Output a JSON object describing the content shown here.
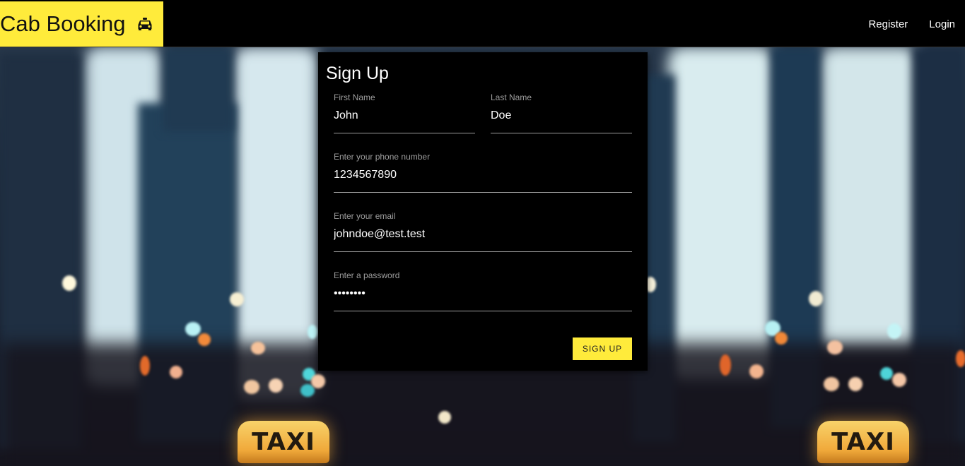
{
  "navbar": {
    "brand": "Cab Booking",
    "brand_icon": "taxi-icon",
    "links": [
      {
        "label": "Register"
      },
      {
        "label": "Login"
      }
    ],
    "brand_color": "#ffeb3b",
    "background": "#000000"
  },
  "background_scene": {
    "taxi_signs": [
      {
        "text": "TAXI"
      },
      {
        "text": "TAXI"
      }
    ]
  },
  "form": {
    "title": "Sign Up",
    "fields": {
      "first_name": {
        "label": "First Name",
        "value": "John"
      },
      "last_name": {
        "label": "Last Name",
        "value": "Doe"
      },
      "phone": {
        "label": "Enter your phone number",
        "value": "1234567890"
      },
      "email": {
        "label": "Enter your email",
        "value": "johndoe@test.test"
      },
      "password": {
        "label": "Enter a password",
        "value": "password"
      }
    },
    "submit_label": "SIGN UP",
    "accent_color": "#ffeb3b"
  }
}
